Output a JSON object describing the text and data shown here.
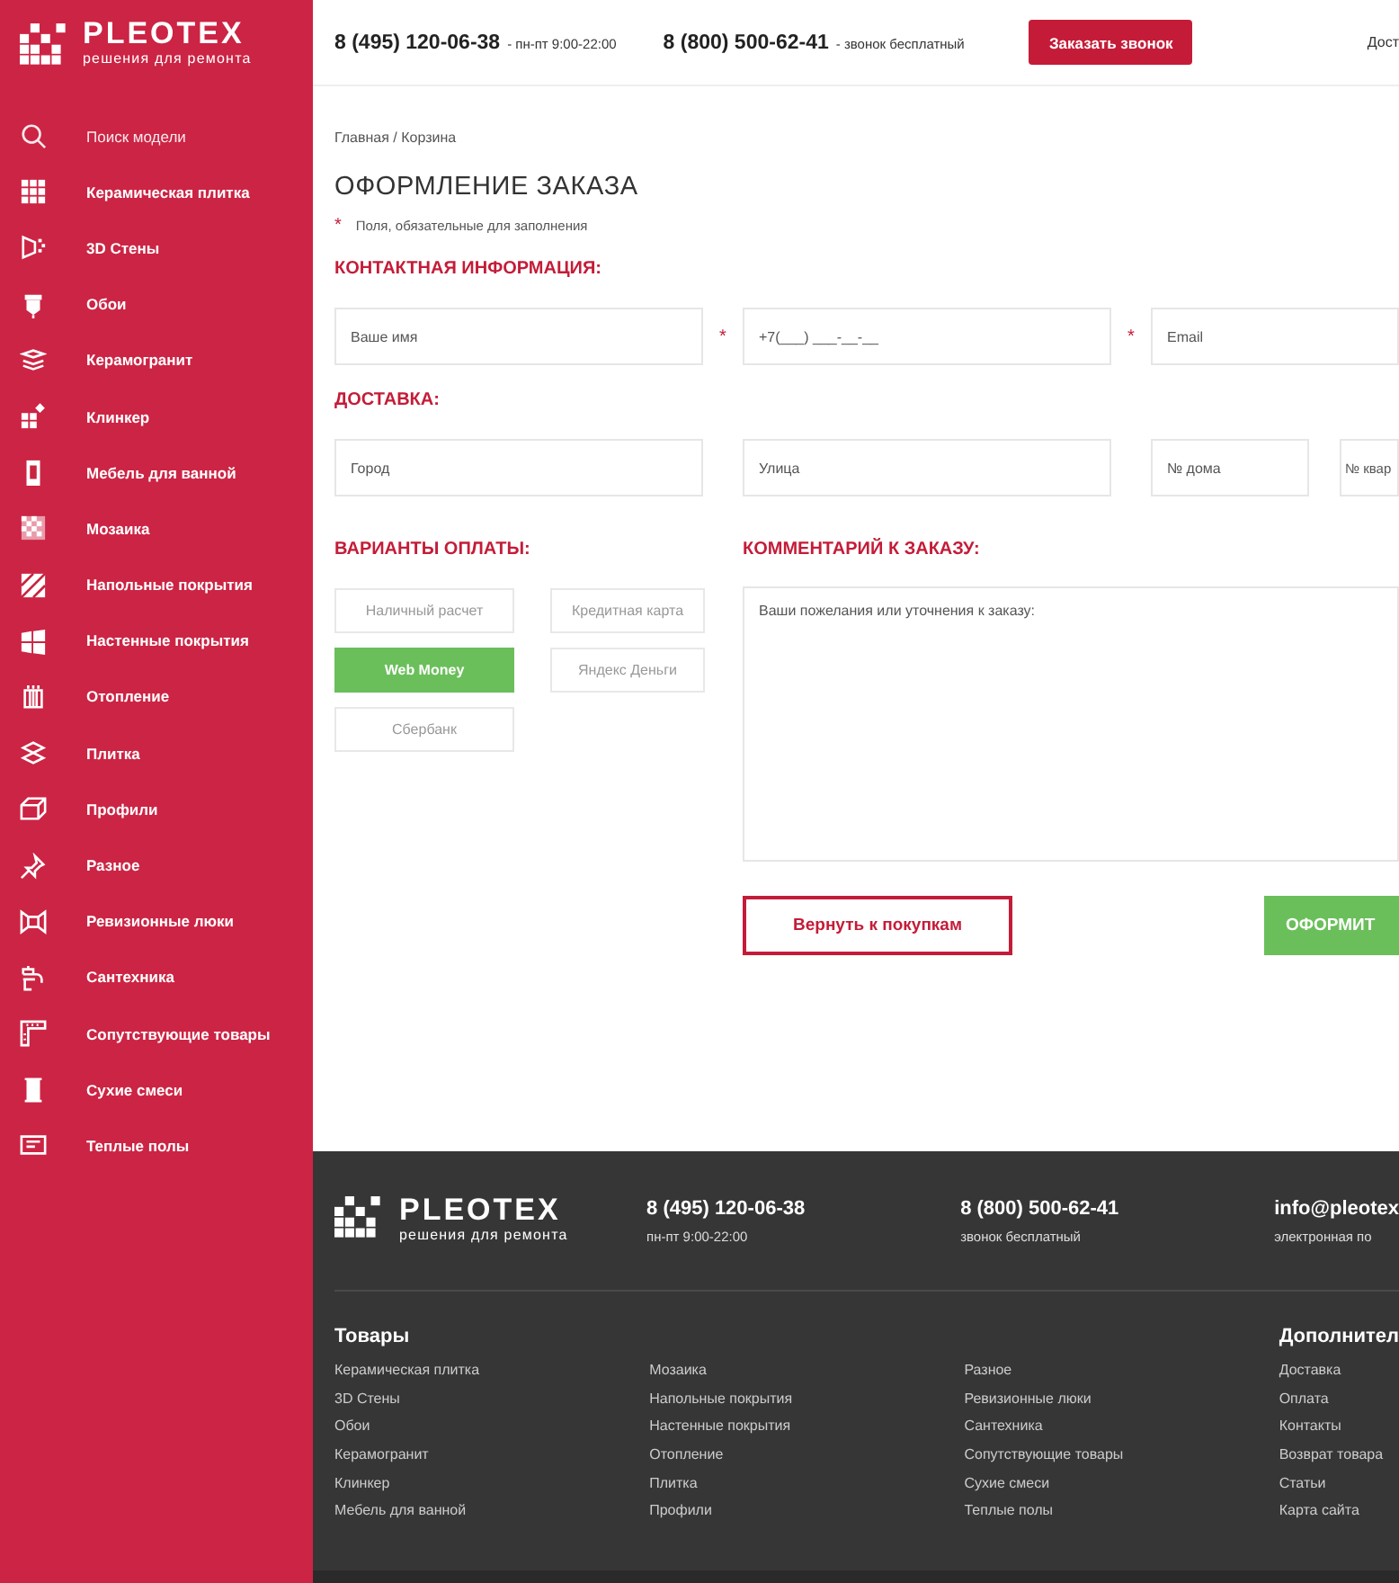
{
  "logo": {
    "name": "PLEOTEX",
    "tagline": "решения для ремонта"
  },
  "sidebar": {
    "items": [
      {
        "label": "Поиск модели",
        "kind": "search"
      },
      {
        "label": "Керамическая плитка",
        "kind": "category"
      },
      {
        "label": "3D Стены",
        "kind": "category"
      },
      {
        "label": "Обои",
        "kind": "category"
      },
      {
        "label": "Керамогранит",
        "kind": "category"
      },
      {
        "label": "Клинкер",
        "kind": "category"
      },
      {
        "label": "Мебель для ванной",
        "kind": "category"
      },
      {
        "label": "Мозаика",
        "kind": "category"
      },
      {
        "label": "Напольные покрытия",
        "kind": "category"
      },
      {
        "label": "Настенные покрытия",
        "kind": "category"
      },
      {
        "label": "Отопление",
        "kind": "category"
      },
      {
        "label": "Плитка",
        "kind": "category"
      },
      {
        "label": "Профили",
        "kind": "category"
      },
      {
        "label": "Разное",
        "kind": "category"
      },
      {
        "label": "Ревизионные люки",
        "kind": "category"
      },
      {
        "label": "Сантехника",
        "kind": "category"
      },
      {
        "label": "Сопутствующие товары",
        "kind": "category"
      },
      {
        "label": "Сухие смеси",
        "kind": "category"
      },
      {
        "label": "Теплые полы",
        "kind": "category"
      }
    ]
  },
  "header": {
    "contacts": [
      {
        "phone": "8 (495) 120-06-38",
        "note": "- пн-пт 9:00-22:00"
      },
      {
        "phone": "8 (800) 500-62-41",
        "note": "- звонок бесплатный"
      }
    ],
    "callback_button": "Заказать звонок",
    "nav_link": "Дост"
  },
  "breadcrumb": "Главная / Корзина",
  "title": "ОФОРМЛЕНИЕ ЗАКАЗА",
  "required_note": {
    "mark": "*",
    "text": "Поля, обязательные для заполнения"
  },
  "contact": {
    "heading": "КОНТАКТНАЯ ИНФОРМАЦИЯ:",
    "fields": [
      {
        "placeholder": "Ваше имя",
        "required_mark": "*"
      },
      {
        "placeholder": "+7(___) ___-__-__",
        "required_mark": "*"
      },
      {
        "placeholder": "Email"
      }
    ]
  },
  "delivery": {
    "heading": "ДОСТАВКА:",
    "fields": [
      {
        "placeholder": "Город"
      },
      {
        "placeholder": "Улица"
      },
      {
        "placeholder": "№ дома"
      },
      {
        "placeholder": "№ квар"
      }
    ]
  },
  "payment": {
    "heading": "ВАРИАНТЫ ОПЛАТЫ:",
    "options": [
      {
        "label": "Наличный расчет",
        "selected": false
      },
      {
        "label": "Кредитная карта",
        "selected": false
      },
      {
        "label": "Web Money",
        "selected": true
      },
      {
        "label": "Яндекс Деньги",
        "selected": false
      },
      {
        "label": "Сбербанк",
        "selected": false
      }
    ]
  },
  "comment": {
    "heading": "КОММЕНТАРИЙ К ЗАКАЗУ:",
    "placeholder": "Ваши пожелания или уточнения к заказу:"
  },
  "buttons": {
    "back": "Вернуть к покупкам",
    "submit": "ОФОРМИТ"
  },
  "footer": {
    "logo": {
      "name": "PLEOTEX",
      "tagline": "решения для ремонта"
    },
    "contacts": [
      {
        "main": "8 (495) 120-06-38",
        "sub": "пн-пт 9:00-22:00"
      },
      {
        "main": "8 (800) 500-62-41",
        "sub": "звонок бесплатный"
      },
      {
        "main": "info@pleotex",
        "sub": "электронная по"
      }
    ],
    "products": {
      "heading": "Товары",
      "columns": [
        [
          "Керамическая плитка",
          "3D Стены",
          "Обои",
          "Керамогранит",
          "Клинкер",
          "Мебель для ванной"
        ],
        [
          "Мозаика",
          "Напольные покрытия",
          "Настенные покрытия",
          "Отопление",
          "Плитка",
          "Профили"
        ],
        [
          "Разное",
          "Ревизионные люки",
          "Сантехника",
          "Сопутствующие товары",
          "Сухие смеси",
          "Теплые полы"
        ]
      ]
    },
    "extra": {
      "heading": "Дополнител",
      "items": [
        "Доставка",
        "Оплата",
        "Контакты",
        "Возврат товара",
        "Статьи",
        "Карта сайта"
      ]
    }
  }
}
